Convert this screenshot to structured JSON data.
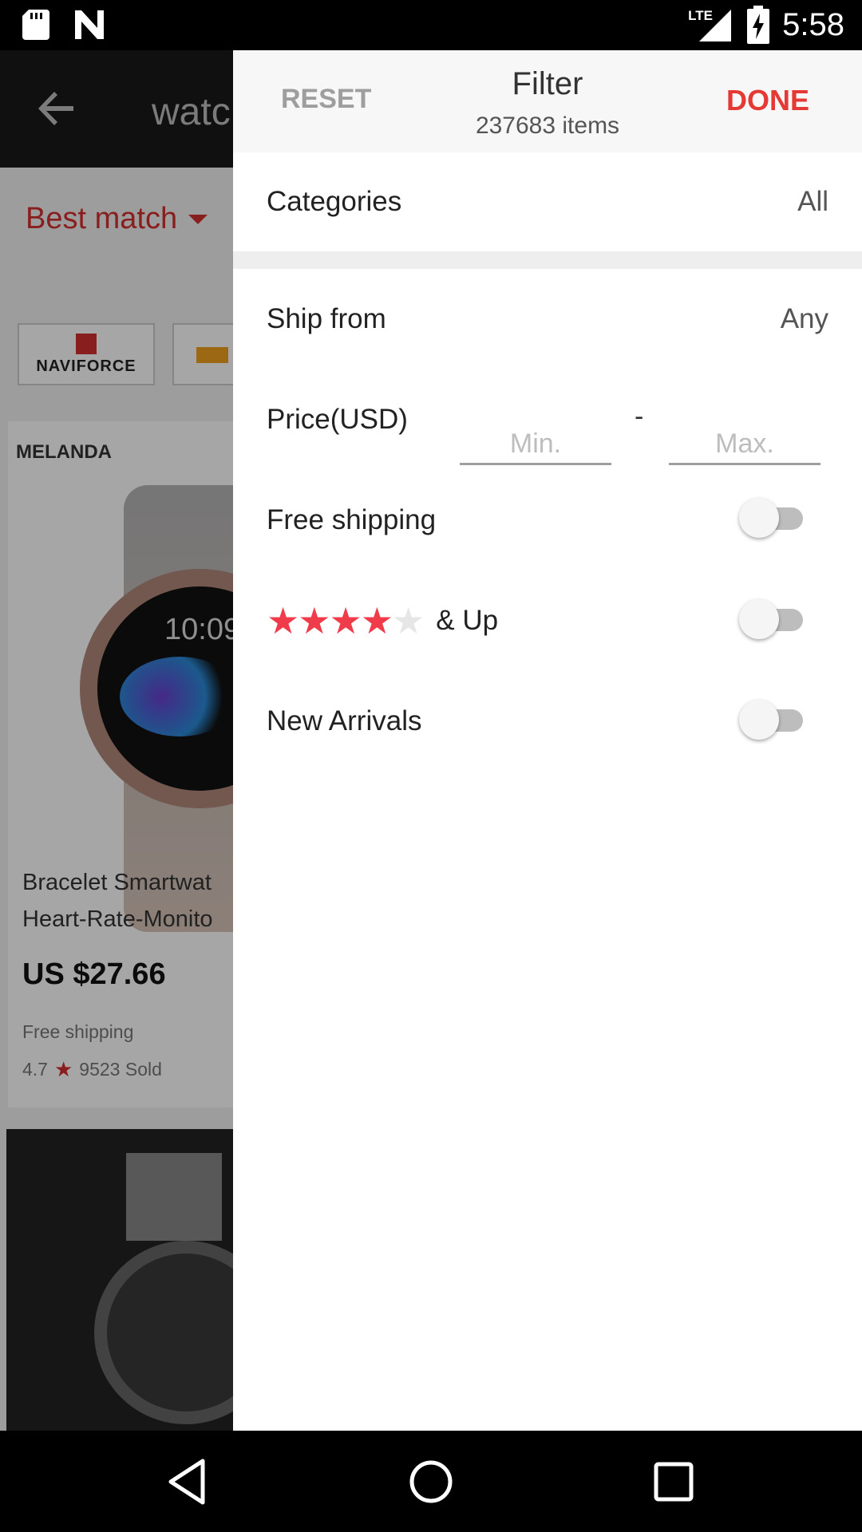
{
  "status_bar": {
    "time": "5:58",
    "network": "LTE",
    "icons": [
      "sd-card-icon",
      "notification-n-icon",
      "signal-icon",
      "battery-charging-icon"
    ]
  },
  "background": {
    "search_query": "watc",
    "sort_label": "Best match",
    "brand_chip": "NAVIFORCE",
    "product": {
      "brand": "MELANDA",
      "watch_time": "10:09",
      "title_line1": "Bracelet Smartwat",
      "title_line2": "Heart-Rate-Monito",
      "price": "US $27.66",
      "shipping": "Free shipping",
      "rating": "4.7",
      "sold": "9523 Sold"
    }
  },
  "filter": {
    "reset_label": "RESET",
    "title": "Filter",
    "items_count": "237683 items",
    "done_label": "DONE",
    "categories": {
      "label": "Categories",
      "value": "All"
    },
    "ship_from": {
      "label": "Ship from",
      "value": "Any"
    },
    "price": {
      "label": "Price(USD)",
      "min_placeholder": "Min.",
      "max_placeholder": "Max.",
      "dash": "-"
    },
    "free_shipping": {
      "label": "Free shipping",
      "on": false
    },
    "rating": {
      "stars_filled": 4,
      "stars_total": 5,
      "label": "& Up",
      "on": false
    },
    "new_arrivals": {
      "label": "New Arrivals",
      "on": false
    }
  },
  "colors": {
    "accent": "#e53935",
    "star": "#ef3b4a"
  }
}
